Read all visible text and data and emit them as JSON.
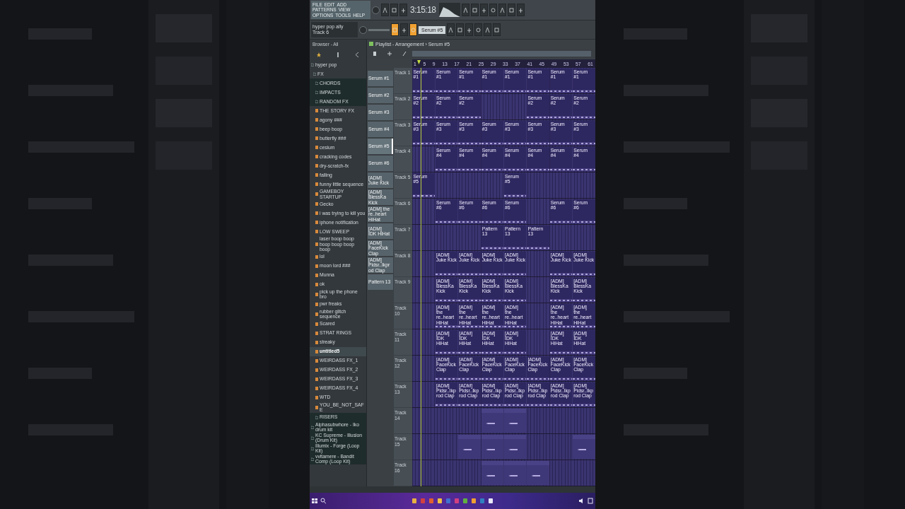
{
  "menu": [
    "FILE",
    "EDIT",
    "ADD",
    "PATTERNS",
    "VIEW",
    "OPTIONS",
    "TOOLS",
    "HELP"
  ],
  "time": "3:15:18",
  "hint": [
    "hyper pop ally",
    "Track 6"
  ],
  "pattern_selector": "Serum #5",
  "playlist_title": "Playlist - Arrangement › Serum #5",
  "browser": {
    "title": "Browser - All",
    "items": [
      {
        "label": "hyper pop",
        "kind": "folder",
        "expanded": true,
        "selected": false,
        "children": [
          {
            "label": "FX",
            "kind": "folder",
            "expanded": true,
            "selected": false,
            "children": [
              {
                "label": "CHORDS",
                "kind": "folder",
                "expanded": false,
                "selected": false
              },
              {
                "label": "IMPACTS",
                "kind": "folder",
                "expanded": false,
                "selected": false
              },
              {
                "label": "RANDOM FX",
                "kind": "folder",
                "expanded": false,
                "selected": false
              },
              {
                "label": "THE STORY FX",
                "kind": "file",
                "selected": false
              },
              {
                "label": "agony ###",
                "kind": "file",
                "selected": false
              },
              {
                "label": "beep boop",
                "kind": "file",
                "selected": false
              },
              {
                "label": "butterfly ###",
                "kind": "file",
                "selected": false
              },
              {
                "label": "cesium",
                "kind": "file",
                "selected": false
              },
              {
                "label": "cracking codes",
                "kind": "file",
                "selected": false
              },
              {
                "label": "dry-scratch-fx",
                "kind": "file",
                "selected": false
              },
              {
                "label": "falling",
                "kind": "file",
                "selected": false
              },
              {
                "label": "funny little sequence",
                "kind": "file",
                "selected": false
              },
              {
                "label": "GAMEBOY STARTUP",
                "kind": "file",
                "selected": false
              },
              {
                "label": "Gecko",
                "kind": "file",
                "selected": false
              },
              {
                "label": "i was trying to kill you",
                "kind": "file",
                "selected": false
              },
              {
                "label": "iphone notification",
                "kind": "file",
                "selected": false
              },
              {
                "label": "LOW SWEEP",
                "kind": "file",
                "selected": false
              },
              {
                "label": "laser boop boop boop boop boop boop",
                "kind": "file",
                "selected": false
              },
              {
                "label": "lol",
                "kind": "file",
                "selected": false
              },
              {
                "label": "moon lord ###",
                "kind": "file",
                "selected": false
              },
              {
                "label": "Munna",
                "kind": "file",
                "selected": false
              },
              {
                "label": "ok",
                "kind": "file",
                "selected": false
              },
              {
                "label": "pick up the phone bro",
                "kind": "file",
                "selected": false
              },
              {
                "label": "pwr freaks",
                "kind": "file",
                "selected": false
              },
              {
                "label": "rubber glitch sequence",
                "kind": "file",
                "selected": false
              },
              {
                "label": "Scared",
                "kind": "file",
                "selected": false
              },
              {
                "label": "STRAT RINGS",
                "kind": "file",
                "selected": false
              },
              {
                "label": "streaky",
                "kind": "file",
                "selected": false
              },
              {
                "label": "untitled5",
                "kind": "file",
                "selected": true
              },
              {
                "label": "WEIRDASS FX_1",
                "kind": "file",
                "selected": false
              },
              {
                "label": "WEIRDASS FX_2",
                "kind": "file",
                "selected": false
              },
              {
                "label": "WEIRDASS FX_3",
                "kind": "file",
                "selected": false
              },
              {
                "label": "WEIRDASS FX_4",
                "kind": "file",
                "selected": false
              },
              {
                "label": "WTD",
                "kind": "file",
                "selected": false
              },
              {
                "label": "YOU_BE_NOT_SAFE",
                "kind": "file",
                "selected": false
              },
              {
                "label": "RISERS",
                "kind": "folder",
                "expanded": false,
                "selected": false
              }
            ]
          }
        ]
      },
      {
        "label": "Alphasubwhore - Iko drum kit",
        "kind": "folder",
        "expanded": false,
        "selected": false
      },
      {
        "label": "KC Supreme - Illusion (Drum Kit)",
        "kind": "folder",
        "expanded": false,
        "selected": false
      },
      {
        "label": "Illumix - Forge (Loop Kit)",
        "kind": "folder",
        "expanded": false,
        "selected": false
      },
      {
        "label": "vvitamere - Bandit Comp (Loop Kit)",
        "kind": "folder",
        "expanded": false,
        "selected": false
      }
    ]
  },
  "patterns": [
    {
      "label": "Serum #1",
      "selected": false
    },
    {
      "label": "Serum #2",
      "selected": false
    },
    {
      "label": "Serum #3",
      "selected": false
    },
    {
      "label": "Serum #4",
      "selected": false
    },
    {
      "label": "Serum #5",
      "selected": true
    },
    {
      "label": "Serum #6",
      "selected": false
    },
    {
      "label": "[ADM] Juke Kick",
      "selected": false
    },
    {
      "label": "[ADM] BlessKa Kick",
      "selected": false
    },
    {
      "label": "[ADM] the re..heart HiHat",
      "selected": false
    },
    {
      "label": "[ADM] IDK HiHat",
      "selected": false
    },
    {
      "label": "[ADM] FaceKick Clap",
      "selected": false
    },
    {
      "label": "[ADM] Pidsr..Ikprod Clap",
      "selected": false
    },
    {
      "label": "Pattern 13",
      "selected": false
    }
  ],
  "ruler": [
    "1",
    "5",
    "9",
    "13",
    "17",
    "21",
    "25",
    "29",
    "33",
    "37",
    "41",
    "45",
    "49",
    "53",
    "57",
    "61"
  ],
  "tracks": [
    {
      "name": "Track 1",
      "slots": [
        {
          "kind": "clip",
          "label": "Serum #1"
        },
        {
          "kind": "clip",
          "label": "Serum #1"
        },
        {
          "kind": "clip",
          "label": "Serum #1"
        },
        {
          "kind": "clip",
          "label": "Serum #1"
        },
        {
          "kind": "clip",
          "label": "Serum #1"
        },
        {
          "kind": "clip",
          "label": "Serum #1"
        },
        {
          "kind": "clip",
          "label": "Serum #1"
        },
        {
          "kind": "clip",
          "label": "Serum #1"
        }
      ]
    },
    {
      "name": "Track 2",
      "slots": [
        {
          "kind": "clip",
          "label": "Serum #2"
        },
        {
          "kind": "clip",
          "label": "Serum #2"
        },
        {
          "kind": "clip",
          "label": "Serum #2"
        },
        {
          "kind": "empty"
        },
        {
          "kind": "empty"
        },
        {
          "kind": "clip",
          "label": "Serum #2"
        },
        {
          "kind": "clip",
          "label": "Serum #2"
        },
        {
          "kind": "clip",
          "label": "Serum #2"
        }
      ]
    },
    {
      "name": "Track 3",
      "slots": [
        {
          "kind": "clip",
          "label": "Serum #3"
        },
        {
          "kind": "clip",
          "label": "Serum #3"
        },
        {
          "kind": "clip",
          "label": "Serum #3"
        },
        {
          "kind": "clip",
          "label": "Serum #3"
        },
        {
          "kind": "clip",
          "label": "Serum #3"
        },
        {
          "kind": "clip",
          "label": "Serum #3"
        },
        {
          "kind": "clip",
          "label": "Serum #3"
        },
        {
          "kind": "clip",
          "label": "Serum #3"
        }
      ]
    },
    {
      "name": "Track 4",
      "slots": [
        {
          "kind": "empty"
        },
        {
          "kind": "clip",
          "label": "Serum #4"
        },
        {
          "kind": "clip",
          "label": "Serum #4"
        },
        {
          "kind": "clip",
          "label": "Serum #4"
        },
        {
          "kind": "clip",
          "label": "Serum #4"
        },
        {
          "kind": "clip",
          "label": "Serum #4"
        },
        {
          "kind": "clip",
          "label": "Serum #4"
        },
        {
          "kind": "clip",
          "label": "Serum #4"
        }
      ]
    },
    {
      "name": "Track 5",
      "slots": [
        {
          "kind": "clip",
          "label": "Serum #5"
        },
        {
          "kind": "empty"
        },
        {
          "kind": "empty"
        },
        {
          "kind": "empty"
        },
        {
          "kind": "clip",
          "label": "Serum #5"
        },
        {
          "kind": "empty"
        },
        {
          "kind": "empty"
        },
        {
          "kind": "empty"
        }
      ]
    },
    {
      "name": "Track 6",
      "slots": [
        {
          "kind": "empty"
        },
        {
          "kind": "clip",
          "label": "Serum #6"
        },
        {
          "kind": "clip",
          "label": "Serum #6"
        },
        {
          "kind": "clip",
          "label": "Serum #6"
        },
        {
          "kind": "clip",
          "label": "Serum #6"
        },
        {
          "kind": "empty"
        },
        {
          "kind": "clip",
          "label": "Serum #6"
        },
        {
          "kind": "clip",
          "label": "Serum #6"
        }
      ]
    },
    {
      "name": "Track 7",
      "slots": [
        {
          "kind": "empty"
        },
        {
          "kind": "empty"
        },
        {
          "kind": "empty"
        },
        {
          "kind": "clip",
          "label": "Pattern 13"
        },
        {
          "kind": "clip",
          "label": "Pattern 13"
        },
        {
          "kind": "clip",
          "label": "Pattern 13"
        },
        {
          "kind": "empty"
        },
        {
          "kind": "empty"
        }
      ]
    },
    {
      "name": "Track 8",
      "slots": [
        {
          "kind": "empty"
        },
        {
          "kind": "clip",
          "label": "[ADM] Juke Kick"
        },
        {
          "kind": "clip",
          "label": "[ADM] Juke Kick"
        },
        {
          "kind": "clip",
          "label": "[ADM] Juke Kick"
        },
        {
          "kind": "clip",
          "label": "[ADM] Juke Kick"
        },
        {
          "kind": "empty"
        },
        {
          "kind": "clip",
          "label": "[ADM] Juke Kick"
        },
        {
          "kind": "clip",
          "label": "[ADM] Juke Kick"
        }
      ]
    },
    {
      "name": "Track 9",
      "slots": [
        {
          "kind": "empty"
        },
        {
          "kind": "clip",
          "label": "[ADM] BlessKa Kick"
        },
        {
          "kind": "clip",
          "label": "[ADM] BlessKa Kick"
        },
        {
          "kind": "clip",
          "label": "[ADM] BlessKa Kick"
        },
        {
          "kind": "clip",
          "label": "[ADM] BlessKa Kick"
        },
        {
          "kind": "empty"
        },
        {
          "kind": "clip",
          "label": "[ADM] BlessKa Kick"
        },
        {
          "kind": "clip",
          "label": "[ADM] BlessKa Kick"
        }
      ]
    },
    {
      "name": "Track 10",
      "slots": [
        {
          "kind": "empty"
        },
        {
          "kind": "clip",
          "label": "[ADM] the re..heart HiHat"
        },
        {
          "kind": "clip",
          "label": "[ADM] the re..heart HiHat"
        },
        {
          "kind": "clip",
          "label": "[ADM] the re..heart HiHat"
        },
        {
          "kind": "clip",
          "label": "[ADM] the re..heart HiHat"
        },
        {
          "kind": "empty"
        },
        {
          "kind": "clip",
          "label": "[ADM] the re..heart HiHat"
        },
        {
          "kind": "clip",
          "label": "[ADM] the re..heart HiHat"
        }
      ]
    },
    {
      "name": "Track 11",
      "slots": [
        {
          "kind": "empty"
        },
        {
          "kind": "clip",
          "label": "[ADM] IDK HiHat"
        },
        {
          "kind": "clip",
          "label": "[ADM] IDK HiHat"
        },
        {
          "kind": "clip",
          "label": "[ADM] IDK HiHat"
        },
        {
          "kind": "clip",
          "label": "[ADM] IDK HiHat"
        },
        {
          "kind": "empty"
        },
        {
          "kind": "clip",
          "label": "[ADM] IDK HiHat"
        },
        {
          "kind": "clip",
          "label": "[ADM] IDK HiHat"
        }
      ]
    },
    {
      "name": "Track 12",
      "slots": [
        {
          "kind": "empty"
        },
        {
          "kind": "clip",
          "label": "[ADM] FaceKick Clap"
        },
        {
          "kind": "clip",
          "label": "[ADM] FaceKick Clap"
        },
        {
          "kind": "clip",
          "label": "[ADM] FaceKick Clap"
        },
        {
          "kind": "clip",
          "label": "[ADM] FaceKick Clap"
        },
        {
          "kind": "clip",
          "label": "[ADM] FaceKick Clap"
        },
        {
          "kind": "clip",
          "label": "[ADM] FaceKick Clap"
        },
        {
          "kind": "clip",
          "label": "[ADM] FaceKick Clap"
        }
      ]
    },
    {
      "name": "Track 13",
      "slots": [
        {
          "kind": "empty"
        },
        {
          "kind": "clip",
          "label": "[ADM] Pidsr..Ikprod Clap"
        },
        {
          "kind": "clip",
          "label": "[ADM] Pidsr..Ikprod Clap"
        },
        {
          "kind": "clip",
          "label": "[ADM] Pidsr..Ikprod Clap"
        },
        {
          "kind": "clip",
          "label": "[ADM] Pidsr..Ikprod Clap"
        },
        {
          "kind": "clip",
          "label": "[ADM] Pidsr..Ikprod Clap"
        },
        {
          "kind": "clip",
          "label": "[ADM] Pidsr..Ikprod Clap"
        },
        {
          "kind": "clip",
          "label": "[ADM] Pidsr..Ikprod Clap"
        }
      ]
    },
    {
      "name": "Track 14",
      "slots": [
        {
          "kind": "empty"
        },
        {
          "kind": "empty"
        },
        {
          "kind": "empty"
        },
        {
          "kind": "clip"
        },
        {
          "kind": "clip"
        },
        {
          "kind": "empty"
        },
        {
          "kind": "empty"
        },
        {
          "kind": "empty"
        }
      ]
    },
    {
      "name": "Track 15",
      "slots": [
        {
          "kind": "empty"
        },
        {
          "kind": "empty"
        },
        {
          "kind": "clip"
        },
        {
          "kind": "clip"
        },
        {
          "kind": "clip"
        },
        {
          "kind": "empty"
        },
        {
          "kind": "empty"
        },
        {
          "kind": "clip"
        }
      ]
    },
    {
      "name": "Track 16",
      "slots": [
        {
          "kind": "empty"
        },
        {
          "kind": "empty"
        },
        {
          "kind": "empty"
        },
        {
          "kind": "clip"
        },
        {
          "kind": "clip"
        },
        {
          "kind": "clip"
        },
        {
          "kind": "empty"
        },
        {
          "kind": "empty"
        }
      ]
    }
  ]
}
